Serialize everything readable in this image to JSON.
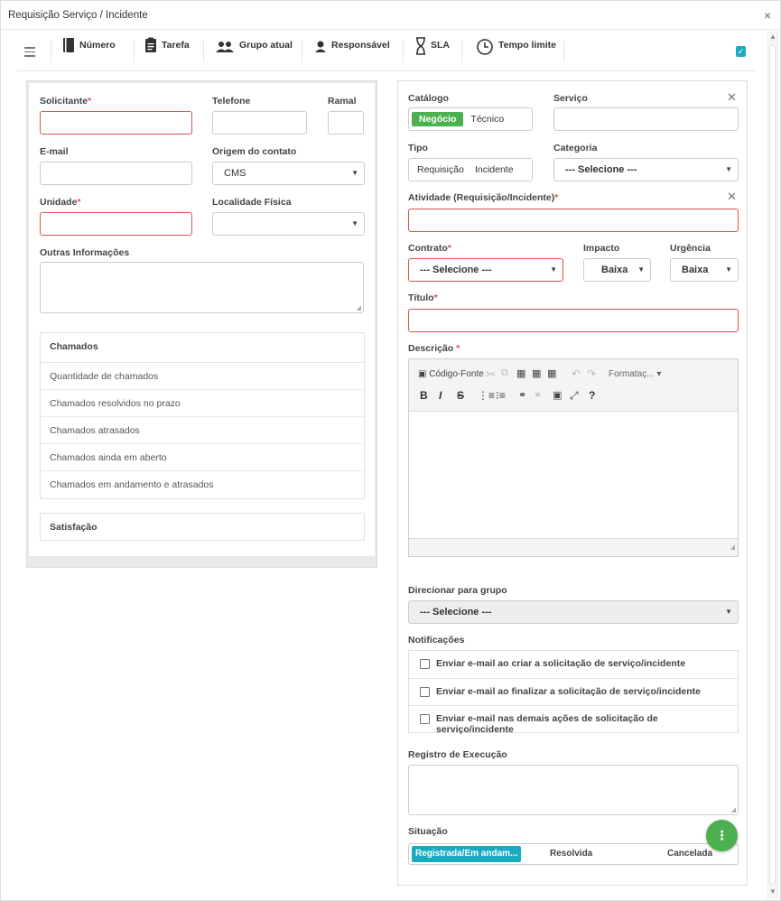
{
  "window": {
    "title": "Requisição Serviço / Incidente",
    "close": "×"
  },
  "toolbar": {
    "items": [
      {
        "label": "Número",
        "icon": "book-icon"
      },
      {
        "label": "Tarefa",
        "icon": "clipboard-icon"
      },
      {
        "label": "Grupo atual",
        "icon": "group-icon"
      },
      {
        "label": "Responsável",
        "icon": "user-icon"
      },
      {
        "label": "SLA",
        "icon": "hourglass-icon"
      },
      {
        "label": "Tempo limite",
        "icon": "clock-icon"
      }
    ],
    "check": "✓"
  },
  "left": {
    "solicitante": "Solicitante",
    "telefone": "Telefone",
    "ramal": "Ramal",
    "email": "E-mail",
    "origem": "Origem do contato",
    "origem_value": "CMS",
    "unidade": "Unidade",
    "localidade": "Localidade Física",
    "outras": "Outras Informações",
    "chamados": {
      "title": "Chamados",
      "rows": [
        "Quantidade de chamados",
        "Chamados resolvidos no prazo",
        "Chamados atrasados",
        "Chamados ainda em aberto",
        "Chamados em andamento e atrasados"
      ]
    },
    "satisfacao": "Satisfação"
  },
  "right": {
    "catalogo": "Catálogo",
    "catalogo_opts": [
      "Negócio",
      "Técnico"
    ],
    "servico": "Serviço",
    "tipo": "Tipo",
    "tipo_opts": [
      "Requisição",
      "Incidente"
    ],
    "categoria": "Categoria",
    "categoria_value": "--- Selecione ---",
    "atividade": "Atividade (Requisição/Incidente)",
    "contrato": "Contrato",
    "contrato_value": "--- Selecione ---",
    "impacto": "Impacto",
    "impacto_value": "Baixa",
    "urgencia": "Urgência",
    "urgencia_value": "Baixa",
    "titulo": "Título",
    "descricao": "Descrição",
    "editor": {
      "source": "Código-Fonte",
      "format": "Formataç...",
      "bold": "B",
      "italic": "I",
      "strike": "S",
      "help": "?"
    },
    "direcionar": "Direcionar para grupo",
    "direcionar_value": "--- Selecione ---",
    "notificacoes": "Notificações",
    "notif_items": [
      "Enviar e-mail ao criar a solicitação de serviço/incidente",
      "Enviar e-mail ao finalizar a solicitação de serviço/incidente",
      "Enviar e-mail nas demais ações de solicitação de serviço/incidente"
    ],
    "registro": "Registro de Execução",
    "situacao": "Situação",
    "situacao_opts": [
      "Registrada/Em andam...",
      "Resolvida",
      "Cancelada"
    ]
  },
  "fab": "⋮",
  "colors": {
    "accent": "#4cb050",
    "teal": "#1aabc1",
    "required": "#d9534f"
  }
}
